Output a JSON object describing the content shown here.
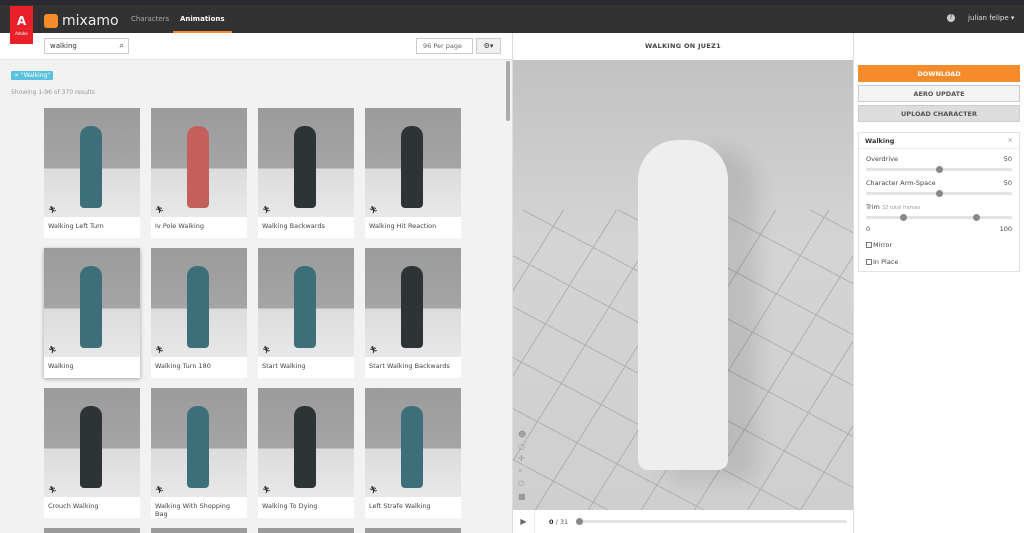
{
  "header": {
    "adobe": "Adobe",
    "brand": "mixamo",
    "nav": [
      "Characters",
      "Animations"
    ],
    "active_nav": "Animations",
    "user": "julian felipe ▾",
    "help": "?"
  },
  "search": {
    "value": "walking",
    "per_page": "96 Per page",
    "filter_tag": "× \"Walking\"",
    "showing": "Showing 1-96 of 370 results"
  },
  "cards": [
    {
      "label": "Walking Left Turn",
      "color": "#3d6f7b"
    },
    {
      "label": "Iv Pole Walking",
      "color": "#c4605c"
    },
    {
      "label": "Walking Backwards",
      "color": "#2e3336"
    },
    {
      "label": "Walking Hit Reaction",
      "color": "#2e3336"
    },
    {
      "label": "Walking",
      "color": "#3d6f7b",
      "selected": true
    },
    {
      "label": "Walking Turn 180",
      "color": "#3d6f7b"
    },
    {
      "label": "Start Walking",
      "color": "#3d6f7b"
    },
    {
      "label": "Start Walking Backwards",
      "color": "#2e3336"
    },
    {
      "label": "Crouch Walking",
      "color": "#2e3336"
    },
    {
      "label": "Walking With Shopping Bag",
      "color": "#3d6f7b"
    },
    {
      "label": "Walking To Dying",
      "color": "#2e3336"
    },
    {
      "label": "Left Strafe Walking",
      "color": "#3d6f7b"
    }
  ],
  "viewer": {
    "title": "WALKING ON JUEZ1",
    "frame_current": "0",
    "frame_total": "/ 31",
    "progress": 0
  },
  "actions": {
    "download": "DOWNLOAD",
    "aero": "AERO UPDATE",
    "upload": "UPLOAD CHARACTER"
  },
  "settings": {
    "title": "Walking",
    "close": "×",
    "overdrive_label": "Overdrive",
    "overdrive": "50",
    "arm_label": "Character Arm-Space",
    "arm": "50",
    "trim_label": "Trim",
    "trim_note": "32 total frames",
    "trim_min": "0",
    "trim_max": "100",
    "trim_start": 25,
    "trim_end": 75,
    "mirror": "Mirror",
    "inplace": "In Place"
  },
  "colors": {
    "accent": "#f58b2a",
    "tag": "#5bc0de"
  }
}
